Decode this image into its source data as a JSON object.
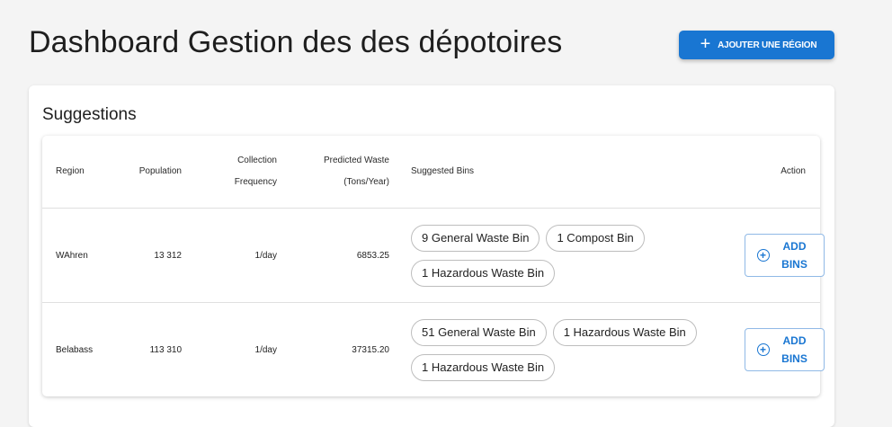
{
  "header": {
    "title": "Dashboard Gestion des des dépotoires",
    "add_region_label": "AJOUTER UNE RÉGION",
    "add_region_icon": "plus-icon",
    "accent_color": "#1976d2"
  },
  "suggestions": {
    "title": "Suggestions",
    "columns": {
      "region": "Region",
      "population": "Population",
      "collection_frequency": "Collection Frequency",
      "predicted_waste": "Predicted Waste (Tons/Year)",
      "suggested_bins": "Suggested Bins",
      "action": "Action"
    },
    "rows": [
      {
        "region": "WAhren",
        "population": "13 312",
        "collection_frequency": "1/day",
        "predicted_waste": "6853.25",
        "bins": [
          "9 General Waste Bin",
          "1 Compost Bin",
          "1 Hazardous Waste Bin"
        ],
        "action_label": "ADD BINS",
        "action_icon": "add-circle-icon"
      },
      {
        "region": "Belabass",
        "population": "113 310",
        "collection_frequency": "1/day",
        "predicted_waste": "37315.20",
        "bins": [
          "51 General Waste Bin",
          "1 Hazardous Waste Bin",
          "1 Hazardous Waste Bin"
        ],
        "action_label": "ADD BINS",
        "action_icon": "add-circle-icon"
      }
    ]
  }
}
